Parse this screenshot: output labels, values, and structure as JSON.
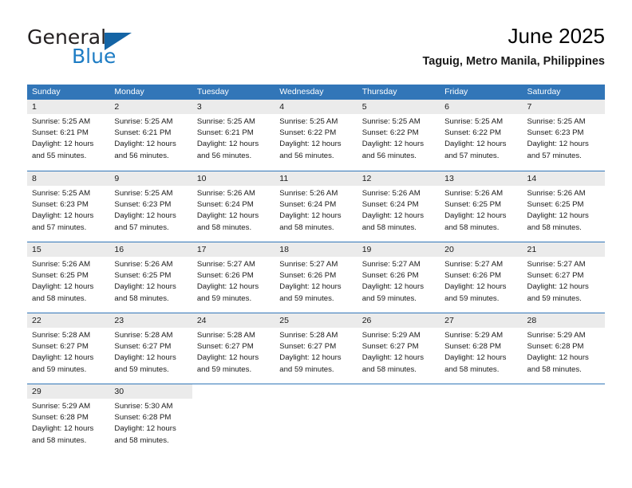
{
  "brand": {
    "name_top": "General",
    "name_bottom": "Blue",
    "triangle_icon": "brand-triangle-icon",
    "color_dark": "#231f20",
    "color_blue": "#1d7cc4",
    "color_triangle": "#1464a5"
  },
  "header": {
    "month_title": "June 2025",
    "location": "Taguig, Metro Manila, Philippines"
  },
  "theme": {
    "header_blue": "#3276b8",
    "daynum_gray": "#ebebeb",
    "text": "#1a1a1a"
  },
  "calendar": {
    "weekday_headers": [
      "Sunday",
      "Monday",
      "Tuesday",
      "Wednesday",
      "Thursday",
      "Friday",
      "Saturday"
    ],
    "weeks": [
      [
        {
          "day": "1",
          "lines": [
            "Sunrise: 5:25 AM",
            "Sunset: 6:21 PM",
            "Daylight: 12 hours",
            "and 55 minutes."
          ]
        },
        {
          "day": "2",
          "lines": [
            "Sunrise: 5:25 AM",
            "Sunset: 6:21 PM",
            "Daylight: 12 hours",
            "and 56 minutes."
          ]
        },
        {
          "day": "3",
          "lines": [
            "Sunrise: 5:25 AM",
            "Sunset: 6:21 PM",
            "Daylight: 12 hours",
            "and 56 minutes."
          ]
        },
        {
          "day": "4",
          "lines": [
            "Sunrise: 5:25 AM",
            "Sunset: 6:22 PM",
            "Daylight: 12 hours",
            "and 56 minutes."
          ]
        },
        {
          "day": "5",
          "lines": [
            "Sunrise: 5:25 AM",
            "Sunset: 6:22 PM",
            "Daylight: 12 hours",
            "and 56 minutes."
          ]
        },
        {
          "day": "6",
          "lines": [
            "Sunrise: 5:25 AM",
            "Sunset: 6:22 PM",
            "Daylight: 12 hours",
            "and 57 minutes."
          ]
        },
        {
          "day": "7",
          "lines": [
            "Sunrise: 5:25 AM",
            "Sunset: 6:23 PM",
            "Daylight: 12 hours",
            "and 57 minutes."
          ]
        }
      ],
      [
        {
          "day": "8",
          "lines": [
            "Sunrise: 5:25 AM",
            "Sunset: 6:23 PM",
            "Daylight: 12 hours",
            "and 57 minutes."
          ]
        },
        {
          "day": "9",
          "lines": [
            "Sunrise: 5:25 AM",
            "Sunset: 6:23 PM",
            "Daylight: 12 hours",
            "and 57 minutes."
          ]
        },
        {
          "day": "10",
          "lines": [
            "Sunrise: 5:26 AM",
            "Sunset: 6:24 PM",
            "Daylight: 12 hours",
            "and 58 minutes."
          ]
        },
        {
          "day": "11",
          "lines": [
            "Sunrise: 5:26 AM",
            "Sunset: 6:24 PM",
            "Daylight: 12 hours",
            "and 58 minutes."
          ]
        },
        {
          "day": "12",
          "lines": [
            "Sunrise: 5:26 AM",
            "Sunset: 6:24 PM",
            "Daylight: 12 hours",
            "and 58 minutes."
          ]
        },
        {
          "day": "13",
          "lines": [
            "Sunrise: 5:26 AM",
            "Sunset: 6:25 PM",
            "Daylight: 12 hours",
            "and 58 minutes."
          ]
        },
        {
          "day": "14",
          "lines": [
            "Sunrise: 5:26 AM",
            "Sunset: 6:25 PM",
            "Daylight: 12 hours",
            "and 58 minutes."
          ]
        }
      ],
      [
        {
          "day": "15",
          "lines": [
            "Sunrise: 5:26 AM",
            "Sunset: 6:25 PM",
            "Daylight: 12 hours",
            "and 58 minutes."
          ]
        },
        {
          "day": "16",
          "lines": [
            "Sunrise: 5:26 AM",
            "Sunset: 6:25 PM",
            "Daylight: 12 hours",
            "and 58 minutes."
          ]
        },
        {
          "day": "17",
          "lines": [
            "Sunrise: 5:27 AM",
            "Sunset: 6:26 PM",
            "Daylight: 12 hours",
            "and 59 minutes."
          ]
        },
        {
          "day": "18",
          "lines": [
            "Sunrise: 5:27 AM",
            "Sunset: 6:26 PM",
            "Daylight: 12 hours",
            "and 59 minutes."
          ]
        },
        {
          "day": "19",
          "lines": [
            "Sunrise: 5:27 AM",
            "Sunset: 6:26 PM",
            "Daylight: 12 hours",
            "and 59 minutes."
          ]
        },
        {
          "day": "20",
          "lines": [
            "Sunrise: 5:27 AM",
            "Sunset: 6:26 PM",
            "Daylight: 12 hours",
            "and 59 minutes."
          ]
        },
        {
          "day": "21",
          "lines": [
            "Sunrise: 5:27 AM",
            "Sunset: 6:27 PM",
            "Daylight: 12 hours",
            "and 59 minutes."
          ]
        }
      ],
      [
        {
          "day": "22",
          "lines": [
            "Sunrise: 5:28 AM",
            "Sunset: 6:27 PM",
            "Daylight: 12 hours",
            "and 59 minutes."
          ]
        },
        {
          "day": "23",
          "lines": [
            "Sunrise: 5:28 AM",
            "Sunset: 6:27 PM",
            "Daylight: 12 hours",
            "and 59 minutes."
          ]
        },
        {
          "day": "24",
          "lines": [
            "Sunrise: 5:28 AM",
            "Sunset: 6:27 PM",
            "Daylight: 12 hours",
            "and 59 minutes."
          ]
        },
        {
          "day": "25",
          "lines": [
            "Sunrise: 5:28 AM",
            "Sunset: 6:27 PM",
            "Daylight: 12 hours",
            "and 59 minutes."
          ]
        },
        {
          "day": "26",
          "lines": [
            "Sunrise: 5:29 AM",
            "Sunset: 6:27 PM",
            "Daylight: 12 hours",
            "and 58 minutes."
          ]
        },
        {
          "day": "27",
          "lines": [
            "Sunrise: 5:29 AM",
            "Sunset: 6:28 PM",
            "Daylight: 12 hours",
            "and 58 minutes."
          ]
        },
        {
          "day": "28",
          "lines": [
            "Sunrise: 5:29 AM",
            "Sunset: 6:28 PM",
            "Daylight: 12 hours",
            "and 58 minutes."
          ]
        }
      ],
      [
        {
          "day": "29",
          "lines": [
            "Sunrise: 5:29 AM",
            "Sunset: 6:28 PM",
            "Daylight: 12 hours",
            "and 58 minutes."
          ]
        },
        {
          "day": "30",
          "lines": [
            "Sunrise: 5:30 AM",
            "Sunset: 6:28 PM",
            "Daylight: 12 hours",
            "and 58 minutes."
          ]
        },
        {
          "day": "",
          "lines": []
        },
        {
          "day": "",
          "lines": []
        },
        {
          "day": "",
          "lines": []
        },
        {
          "day": "",
          "lines": []
        },
        {
          "day": "",
          "lines": []
        }
      ]
    ]
  }
}
